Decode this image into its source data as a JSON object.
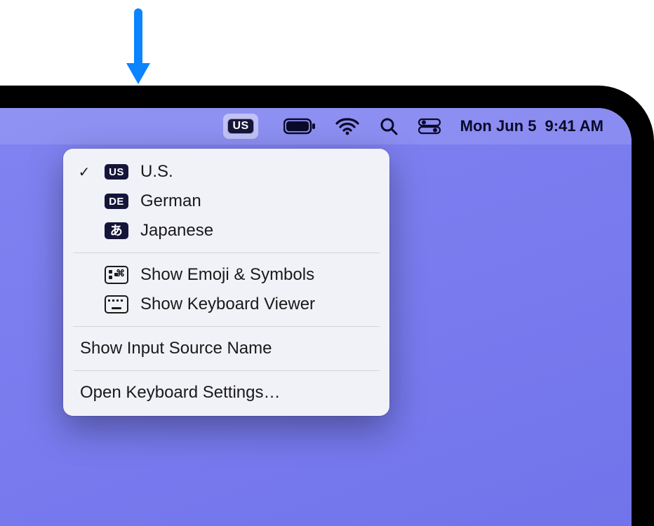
{
  "callout_arrow_target": "input-menu",
  "menubar": {
    "input_source_badge": "US",
    "date": "Mon Jun 5",
    "time": "9:41 AM"
  },
  "input_menu": {
    "sources": [
      {
        "badge": "US",
        "label": "U.S.",
        "selected": true
      },
      {
        "badge": "DE",
        "label": "German",
        "selected": false
      },
      {
        "badge": "あ",
        "label": "Japanese",
        "selected": false
      }
    ],
    "tools": [
      {
        "id": "emoji",
        "label": "Show Emoji & Symbols"
      },
      {
        "id": "keyboard",
        "label": "Show Keyboard Viewer"
      }
    ],
    "options": [
      {
        "label": "Show Input Source Name"
      }
    ],
    "footer": [
      {
        "label": "Open Keyboard Settings…"
      }
    ]
  }
}
